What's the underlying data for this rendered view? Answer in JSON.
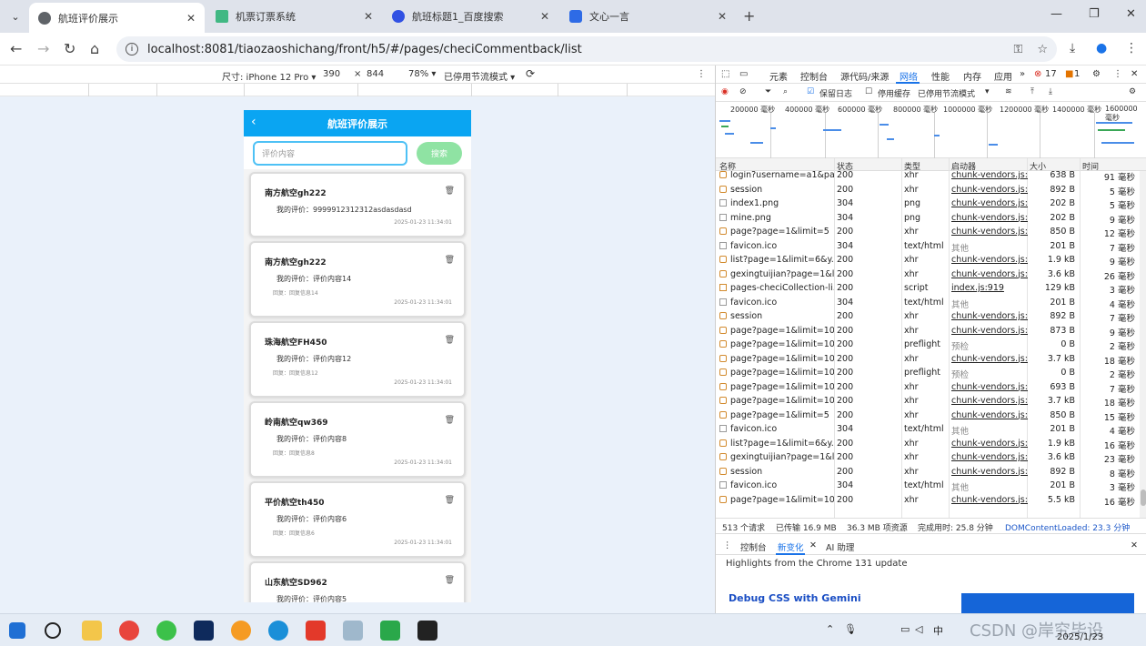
{
  "browser": {
    "tabs": [
      {
        "title": "航班评价展示",
        "active": true
      },
      {
        "title": "机票订票系统",
        "active": false
      },
      {
        "title": "航班标题1_百度搜索",
        "active": false
      },
      {
        "title": "文心一言",
        "active": false
      }
    ],
    "url": "localhost:8081/tiaozaoshichang/front/h5/#/pages/checiCommentback/list"
  },
  "device_toolbar": {
    "device": "尺寸: iPhone 12 Pro ▾",
    "width": "390",
    "times": "×",
    "height": "844",
    "zoom": "78% ▾",
    "throttle": "已停用节流模式 ▾"
  },
  "app": {
    "title": "航班评价展示",
    "search_placeholder": "评价内容",
    "search_button": "搜索",
    "cards": [
      {
        "name": "南方航空gh222",
        "comment": "我的评价：9999912312312asdasdasd",
        "reply": "",
        "time": "2025-01-23 11:34:01"
      },
      {
        "name": "南方航空gh222",
        "comment": "我的评价：评价内容14",
        "reply": "回复：回复信息14",
        "time": "2025-01-23 11:34:01"
      },
      {
        "name": "珠海航空FH450",
        "comment": "我的评价：评价内容12",
        "reply": "回复：回复信息12",
        "time": "2025-01-23 11:34:01"
      },
      {
        "name": "岭南航空qw369",
        "comment": "我的评价：评价内容8",
        "reply": "回复：回复信息8",
        "time": "2025-01-23 11:34:01"
      },
      {
        "name": "平价航空th450",
        "comment": "我的评价：评价内容6",
        "reply": "回复：回复信息6",
        "time": "2025-01-23 11:34:01"
      },
      {
        "name": "山东航空SD962",
        "comment": "我的评价：评价内容5",
        "reply": "",
        "time": ""
      }
    ]
  },
  "devtools": {
    "tabs": [
      "元素",
      "控制台",
      "源代码/来源",
      "网络",
      "性能",
      "内存",
      "应用"
    ],
    "errors": "17",
    "warnings": "1",
    "filter": {
      "preserve_log": "保留日志",
      "disable_cache": "停用缓存",
      "throttle": "已停用节流模式"
    },
    "timeline_ticks": [
      "200000 毫秒",
      "400000 毫秒",
      "600000 毫秒",
      "800000 毫秒",
      "1000000 毫秒",
      "1200000 毫秒",
      "1400000 毫秒",
      "1600000 毫秒"
    ],
    "columns": [
      "名称",
      "状态",
      "类型",
      "启动器",
      "大小",
      "时间"
    ],
    "rows": [
      {
        "name": "login?username=a1&pa...",
        "status": "200",
        "type": "xhr",
        "initiator": "chunk-vendors.js:14",
        "size": "638 B",
        "time": "91 毫秒"
      },
      {
        "name": "session",
        "status": "200",
        "type": "xhr",
        "initiator": "chunk-vendors.js:14",
        "size": "892 B",
        "time": "5 毫秒"
      },
      {
        "name": "index1.png",
        "status": "304",
        "type": "png",
        "initiator": "chunk-vendors.js:91",
        "size": "202 B",
        "time": "5 毫秒"
      },
      {
        "name": "mine.png",
        "status": "304",
        "type": "png",
        "initiator": "chunk-vendors.js:91",
        "size": "202 B",
        "time": "9 毫秒"
      },
      {
        "name": "page?page=1&limit=5",
        "status": "200",
        "type": "xhr",
        "initiator": "chunk-vendors.js:14",
        "size": "850 B",
        "time": "12 毫秒"
      },
      {
        "name": "favicon.ico",
        "status": "304",
        "type": "text/html",
        "initiator": "其他",
        "size": "201 B",
        "time": "7 毫秒"
      },
      {
        "name": "list?page=1&limit=6&y...",
        "status": "200",
        "type": "xhr",
        "initiator": "chunk-vendors.js:14",
        "size": "1.9 kB",
        "time": "9 毫秒"
      },
      {
        "name": "gexingtuijian?page=1&l...",
        "status": "200",
        "type": "xhr",
        "initiator": "chunk-vendors.js:14",
        "size": "3.6 kB",
        "time": "26 毫秒"
      },
      {
        "name": "pages-checiCollection-li...",
        "status": "200",
        "type": "script",
        "initiator": "index.js:919",
        "size": "129 kB",
        "time": "3 毫秒"
      },
      {
        "name": "favicon.ico",
        "status": "304",
        "type": "text/html",
        "initiator": "其他",
        "size": "201 B",
        "time": "4 毫秒"
      },
      {
        "name": "session",
        "status": "200",
        "type": "xhr",
        "initiator": "chunk-vendors.js:14",
        "size": "892 B",
        "time": "7 毫秒"
      },
      {
        "name": "page?page=1&limit=10...",
        "status": "200",
        "type": "xhr",
        "initiator": "chunk-vendors.js:14",
        "size": "873 B",
        "time": "9 毫秒"
      },
      {
        "name": "page?page=1&limit=10",
        "status": "200",
        "type": "preflight",
        "initiator": "预检",
        "size": "0 B",
        "time": "2 毫秒"
      },
      {
        "name": "page?page=1&limit=10",
        "status": "200",
        "type": "xhr",
        "initiator": "chunk-vendors.js:14",
        "size": "3.7 kB",
        "time": "18 毫秒"
      },
      {
        "name": "page?page=1&limit=10...",
        "status": "200",
        "type": "preflight",
        "initiator": "预检",
        "size": "0 B",
        "time": "2 毫秒"
      },
      {
        "name": "page?page=1&limit=10...",
        "status": "200",
        "type": "xhr",
        "initiator": "chunk-vendors.js:14",
        "size": "693 B",
        "time": "7 毫秒"
      },
      {
        "name": "page?page=1&limit=10",
        "status": "200",
        "type": "xhr",
        "initiator": "chunk-vendors.js:14",
        "size": "3.7 kB",
        "time": "18 毫秒"
      },
      {
        "name": "page?page=1&limit=5",
        "status": "200",
        "type": "xhr",
        "initiator": "chunk-vendors.js:14",
        "size": "850 B",
        "time": "15 毫秒"
      },
      {
        "name": "favicon.ico",
        "status": "304",
        "type": "text/html",
        "initiator": "其他",
        "size": "201 B",
        "time": "4 毫秒"
      },
      {
        "name": "list?page=1&limit=6&y...",
        "status": "200",
        "type": "xhr",
        "initiator": "chunk-vendors.js:14",
        "size": "1.9 kB",
        "time": "16 毫秒"
      },
      {
        "name": "gexingtuijian?page=1&l...",
        "status": "200",
        "type": "xhr",
        "initiator": "chunk-vendors.js:14",
        "size": "3.6 kB",
        "time": "23 毫秒"
      },
      {
        "name": "session",
        "status": "200",
        "type": "xhr",
        "initiator": "chunk-vendors.js:14",
        "size": "892 B",
        "time": "8 毫秒"
      },
      {
        "name": "favicon.ico",
        "status": "304",
        "type": "text/html",
        "initiator": "其他",
        "size": "201 B",
        "time": "3 毫秒"
      },
      {
        "name": "page?page=1&limit=10",
        "status": "200",
        "type": "xhr",
        "initiator": "chunk-vendors.js:14",
        "size": "5.5 kB",
        "time": "16 毫秒"
      }
    ],
    "status": {
      "requests": "513 个请求",
      "transferred": "已传输 16.9 MB",
      "resources": "36.3 MB 项资源",
      "finish": "完成用时: 25.8 分钟",
      "dcl": "DOMContentLoaded: 23.3 分钟"
    },
    "drawer_tabs": [
      "控制台",
      "新变化",
      "AI 助理"
    ],
    "drawer_highlight": "Highlights from the Chrome 131 update",
    "drawer_link": "Debug CSS with Gemini"
  },
  "taskbar": {
    "tray_lang": "中",
    "watermark": "CSDN @岸究毕设",
    "date": "2025/1/23"
  }
}
